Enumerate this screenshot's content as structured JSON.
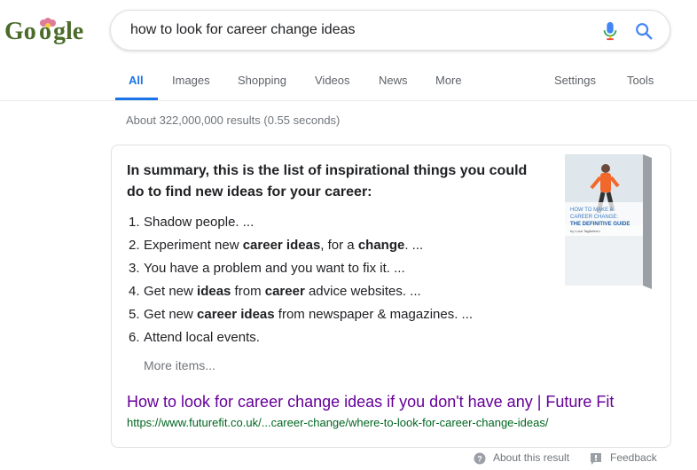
{
  "logo": {
    "text": "Google",
    "icon": "google-logo-flower-doodle"
  },
  "search": {
    "query": "how to look for career change ideas",
    "mic_icon": "microphone-icon",
    "search_icon": "search-icon"
  },
  "tabs": {
    "all": "All",
    "images": "Images",
    "shopping": "Shopping",
    "videos": "Videos",
    "news": "News",
    "more": "More",
    "settings": "Settings",
    "tools": "Tools"
  },
  "result_stats": "About 322,000,000 results (0.55 seconds)",
  "snippet": {
    "heading": "In summary, this is the list of inspirational things you could do to find new ideas for your career:",
    "items": [
      {
        "num": "1.",
        "parts": [
          {
            "t": "Shadow people. ...",
            "b": false
          }
        ]
      },
      {
        "num": "2.",
        "parts": [
          {
            "t": "Experiment new ",
            "b": false
          },
          {
            "t": "career ideas",
            "b": true
          },
          {
            "t": ", for a ",
            "b": false
          },
          {
            "t": "change",
            "b": true
          },
          {
            "t": ". ...",
            "b": false
          }
        ]
      },
      {
        "num": "3.",
        "parts": [
          {
            "t": "You have a problem and you want to fix it. ...",
            "b": false
          }
        ]
      },
      {
        "num": "4.",
        "parts": [
          {
            "t": "Get new ",
            "b": false
          },
          {
            "t": "ideas",
            "b": true
          },
          {
            "t": " from ",
            "b": false
          },
          {
            "t": "career",
            "b": true
          },
          {
            "t": " advice websites. ...",
            "b": false
          }
        ]
      },
      {
        "num": "5.",
        "parts": [
          {
            "t": "Get new ",
            "b": false
          },
          {
            "t": "career ideas",
            "b": true
          },
          {
            "t": " from newspaper & magazines. ...",
            "b": false
          }
        ]
      },
      {
        "num": "6.",
        "parts": [
          {
            "t": "Attend local events.",
            "b": false
          }
        ]
      }
    ],
    "more_items": "More items...",
    "result_title": "How to look for career change ideas if you don't have any | Future Fit",
    "result_url": "https://www.futurefit.co.uk/...career-change/where-to-look-for-career-change-ideas/",
    "book": {
      "line1": "HOW TO MAKE A",
      "line2": "CAREER CHANGE:",
      "line3": "THE DEFINITIVE GUIDE",
      "author": "by Luca Tagliaferro"
    }
  },
  "footer": {
    "about": "About this result",
    "feedback": "Feedback"
  },
  "colors": {
    "link_visited": "#660099",
    "url_green": "#006621",
    "tab_active": "#1a73e8"
  }
}
